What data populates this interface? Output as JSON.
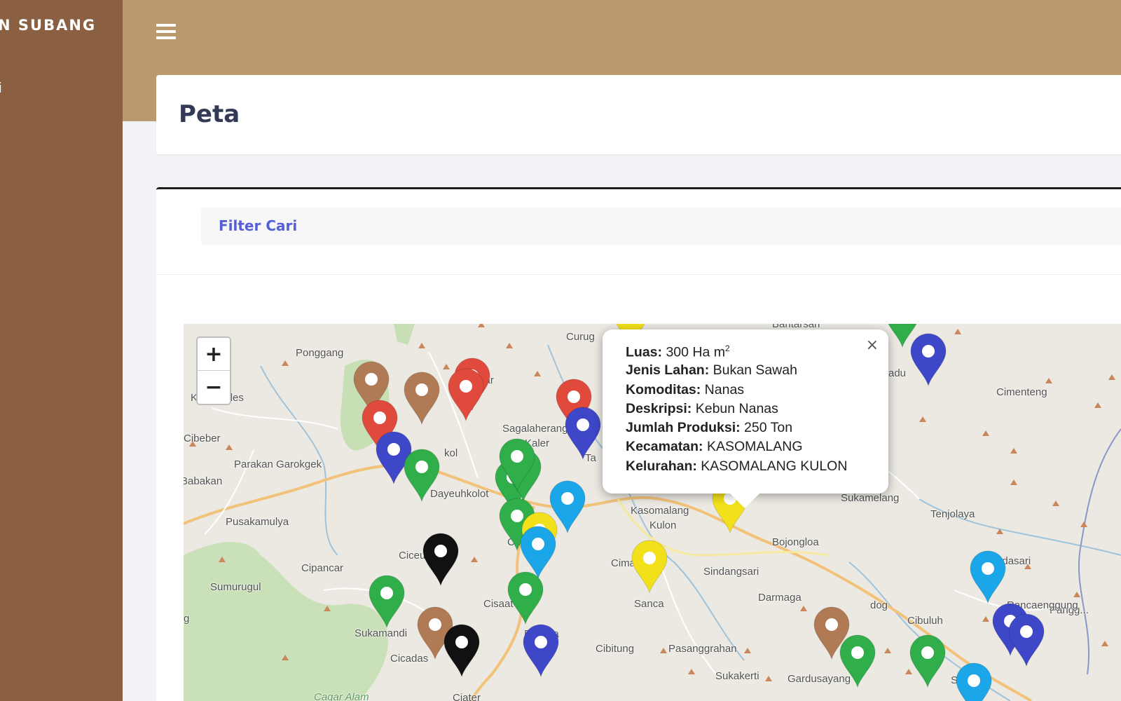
{
  "sidebar": {
    "brand": "N SUBANG",
    "item": "i"
  },
  "header": {
    "page_title": "Peta"
  },
  "filter": {
    "label": "Filter Cari"
  },
  "map": {
    "zoom_in": "+",
    "zoom_out": "−",
    "places": [
      "Bantarsari",
      "Ponggang",
      "Curug",
      "Kiarapedes",
      "Sagalaherang",
      "Kaler",
      "Cibeber",
      "Parakan Garokgek",
      "Babakan",
      "Dayeuhkolot",
      "Pusakamulya",
      "Kasomalang",
      "Kulon",
      "Sukamelang",
      "Tenjolaya",
      "Cimenteng",
      "Bojongloa",
      "Cipancar",
      "Ciceur",
      "Cimang",
      "Sindangsari",
      "Sumurugul",
      "Darmaga",
      "Cibuluh",
      "Cisaat",
      "Sanca",
      "Sukamandi",
      "Cibitung",
      "Pasanggrahan",
      "Cicadas",
      "Sukakerti",
      "Gardusayang",
      "Ciater",
      "Cagar Alam",
      "Gandasari",
      "Pangg...",
      "Sinda...",
      "Cur",
      "kar",
      "kol",
      "adu",
      "dog",
      "Rancaenggung",
      "g",
      "Ta",
      "Pa",
      "sa"
    ],
    "marker_colors": {
      "brown": "#b07a55",
      "red": "#e04a3c",
      "blue": "#3f47c9",
      "green": "#2fae4a",
      "cyan": "#1aa6e8",
      "yellow": "#f2e01a",
      "black": "#111111"
    }
  },
  "popup": {
    "close": "×",
    "rows": [
      {
        "label": "Luas:",
        "value": "300 Ha m",
        "sup": "2"
      },
      {
        "label": "Jenis Lahan:",
        "value": "Bukan Sawah"
      },
      {
        "label": "Komoditas:",
        "value": "Nanas"
      },
      {
        "label": "Deskripsi:",
        "value": "Kebun Nanas"
      },
      {
        "label": "Jumlah Produksi:",
        "value": "250 Ton"
      },
      {
        "label": "Kecamatan:",
        "value": "KASOMALANG"
      },
      {
        "label": "Kelurahan:",
        "value": "KASOMALANG KULON"
      }
    ]
  }
}
